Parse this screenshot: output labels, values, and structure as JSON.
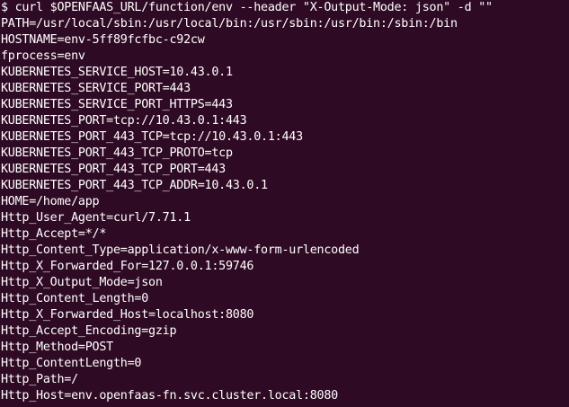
{
  "terminal": {
    "foreground": "#ffffff",
    "background": "#2f0a24",
    "lines": [
      "$ curl $OPENFAAS_URL/function/env --header \"X-Output-Mode: json\" -d \"\"",
      "PATH=/usr/local/sbin:/usr/local/bin:/usr/sbin:/usr/bin:/sbin:/bin",
      "HOSTNAME=env-5ff89fcfbc-c92cw",
      "fprocess=env",
      "KUBERNETES_SERVICE_HOST=10.43.0.1",
      "KUBERNETES_SERVICE_PORT=443",
      "KUBERNETES_SERVICE_PORT_HTTPS=443",
      "KUBERNETES_PORT=tcp://10.43.0.1:443",
      "KUBERNETES_PORT_443_TCP=tcp://10.43.0.1:443",
      "KUBERNETES_PORT_443_TCP_PROTO=tcp",
      "KUBERNETES_PORT_443_TCP_PORT=443",
      "KUBERNETES_PORT_443_TCP_ADDR=10.43.0.1",
      "HOME=/home/app",
      "Http_User_Agent=curl/7.71.1",
      "Http_Accept=*/*",
      "Http_Content_Type=application/x-www-form-urlencoded",
      "Http_X_Forwarded_For=127.0.0.1:59746",
      "Http_X_Output_Mode=json",
      "Http_Content_Length=0",
      "Http_X_Forwarded_Host=localhost:8080",
      "Http_Accept_Encoding=gzip",
      "Http_Method=POST",
      "Http_ContentLength=0",
      "Http_Path=/",
      "Http_Host=env.openfaas-fn.svc.cluster.local:8080"
    ]
  }
}
